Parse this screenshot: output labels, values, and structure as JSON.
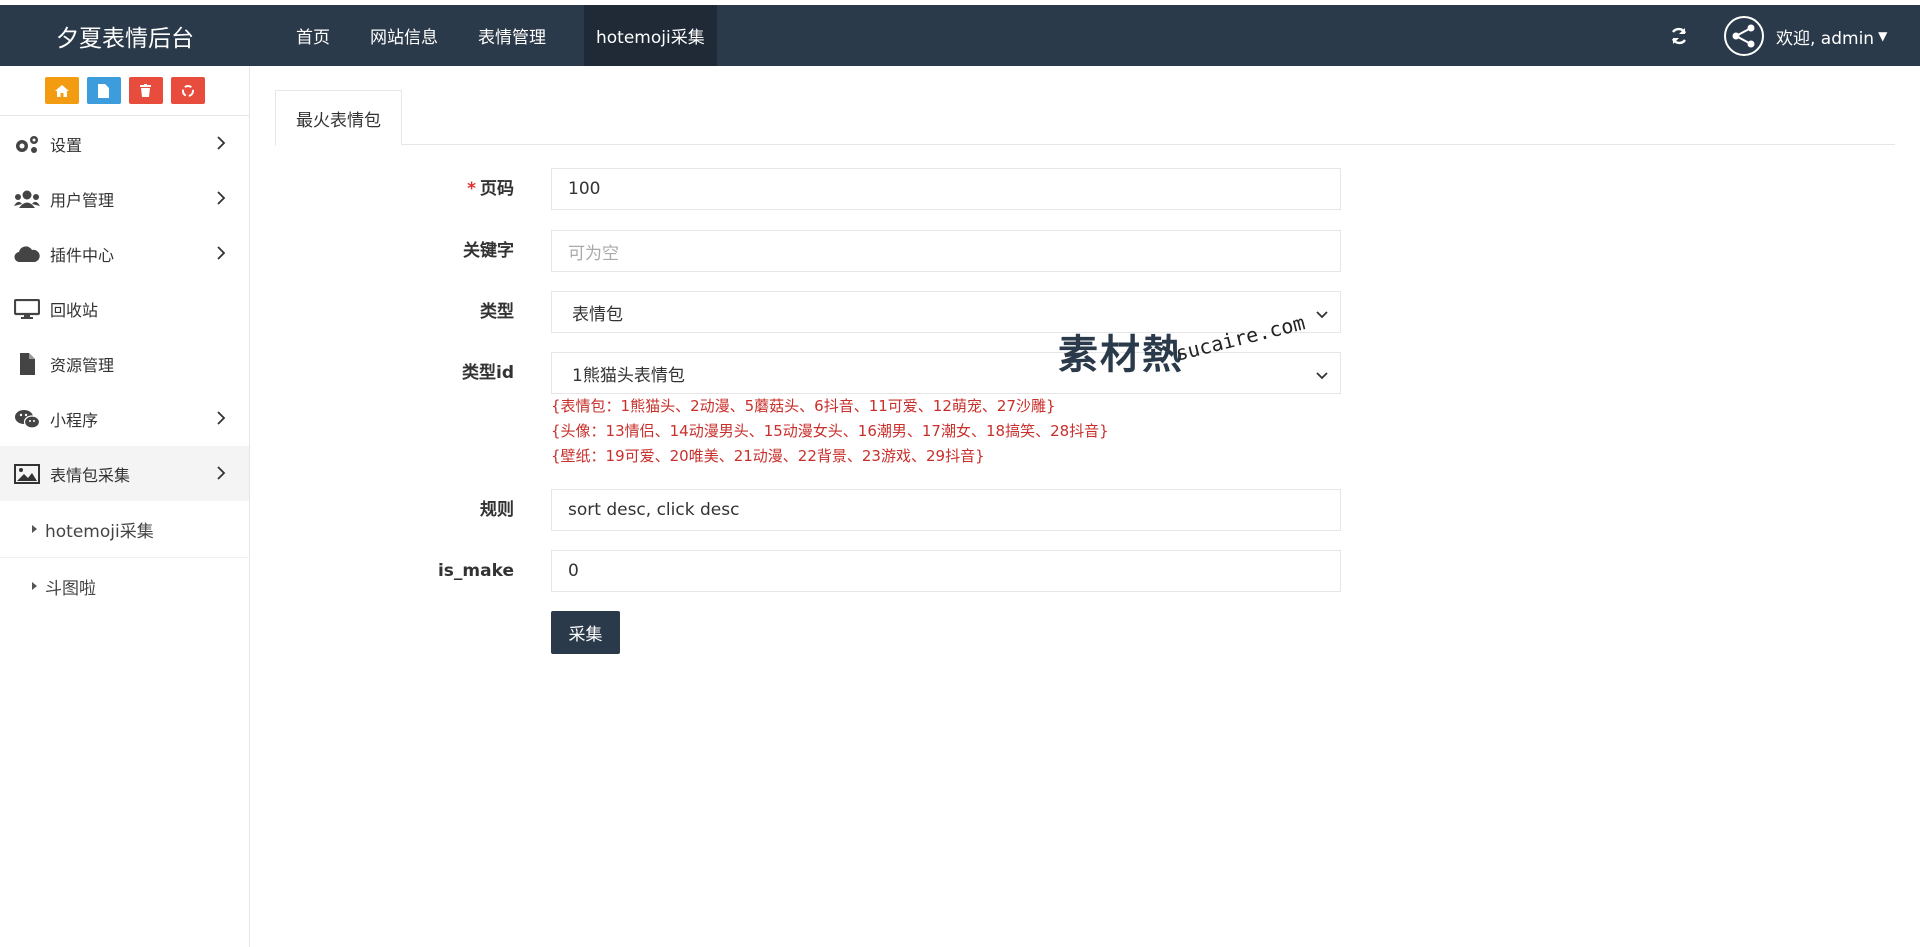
{
  "app": {
    "title": "夕夏表情后台"
  },
  "topnav": {
    "items": [
      {
        "label": "首页"
      },
      {
        "label": "网站信息"
      },
      {
        "label": "表情管理"
      },
      {
        "label": "hotemoji采集"
      }
    ],
    "active_index": 3
  },
  "user": {
    "greeting": "欢迎, admin"
  },
  "sidebar": {
    "quick_buttons": [
      {
        "icon": "home-icon",
        "color": "#f39c12"
      },
      {
        "icon": "file-icon",
        "color": "#3c9cdc"
      },
      {
        "icon": "trash-icon",
        "color": "#e74c3c"
      },
      {
        "icon": "recycle-icon",
        "color": "#e74c3c"
      }
    ],
    "items": [
      {
        "label": "设置",
        "icon": "gears-icon",
        "has_children": true
      },
      {
        "label": "用户管理",
        "icon": "users-icon",
        "has_children": true
      },
      {
        "label": "插件中心",
        "icon": "cloud-icon",
        "has_children": true
      },
      {
        "label": "回收站",
        "icon": "monitor-icon",
        "has_children": false
      },
      {
        "label": "资源管理",
        "icon": "file-icon",
        "has_children": false
      },
      {
        "label": "小程序",
        "icon": "wechat-icon",
        "has_children": true
      },
      {
        "label": "表情包采集",
        "icon": "image-icon",
        "has_children": true
      }
    ],
    "sub_items": [
      {
        "label": "hotemoji采集"
      },
      {
        "label": "斗图啦"
      }
    ]
  },
  "tabs": [
    {
      "label": "最火表情包"
    }
  ],
  "form": {
    "page": {
      "label": "页码",
      "value": "100"
    },
    "keyword": {
      "label": "关键字",
      "placeholder": "可为空"
    },
    "type": {
      "label": "类型",
      "value": "表情包"
    },
    "type_id": {
      "label": "类型id",
      "value": "1熊猫头表情包"
    },
    "hints": [
      "{表情包：1熊猫头、2动漫、5蘑菇头、6抖音、11可爱、12萌宠、27沙雕}",
      "{头像：13情侣、14动漫男头、15动漫女头、16潮男、17潮女、18搞笑、28抖音}",
      "{壁纸：19可爱、20唯美、21动漫、22背景、23游戏、29抖音}"
    ],
    "rule": {
      "label": "规则",
      "value": "sort desc, click desc"
    },
    "is_make": {
      "label": "is_make",
      "value": "0"
    },
    "submit_label": "采集"
  },
  "watermark": {
    "cn": "素材熱",
    "en": "sucaire.com"
  }
}
